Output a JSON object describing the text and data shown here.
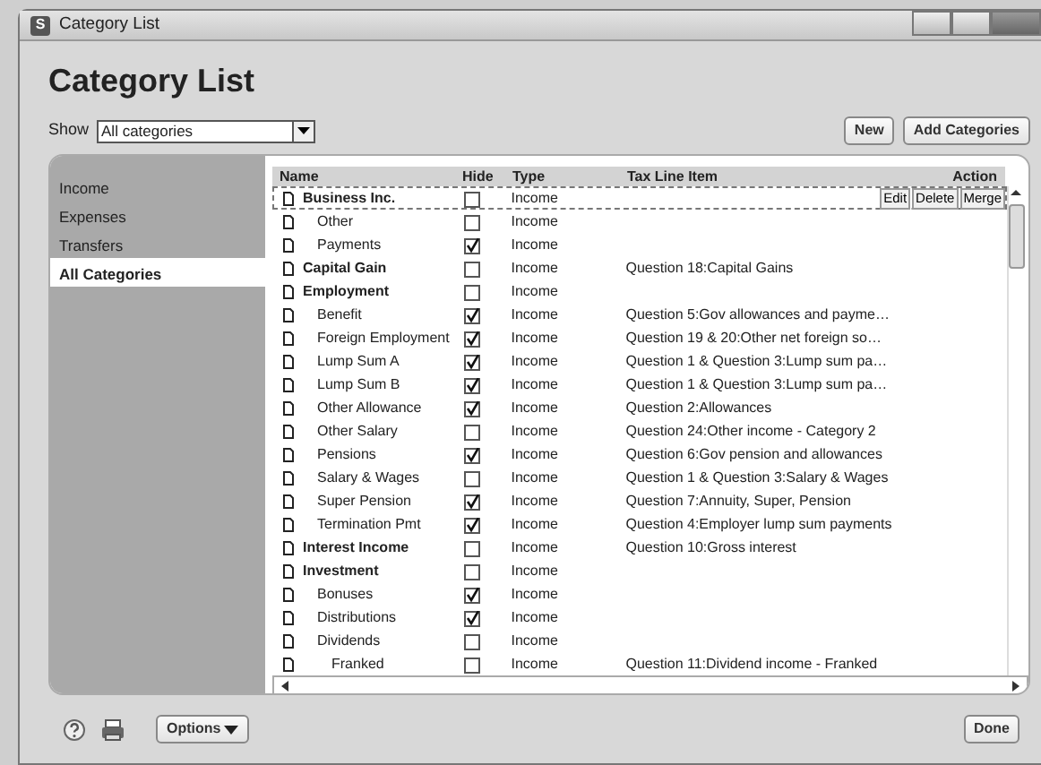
{
  "window": {
    "title": "Category List",
    "app_icon": "S"
  },
  "heading": "Category List",
  "show": {
    "label": "Show",
    "value": "All categories"
  },
  "buttons": [
    "New",
    "Add Categories"
  ],
  "sidebar": {
    "items": [
      {
        "label": "Income",
        "selected": false
      },
      {
        "label": "Expenses",
        "selected": false
      },
      {
        "label": "Transfers",
        "selected": false
      },
      {
        "label": "All Categories",
        "selected": true
      }
    ]
  },
  "table": {
    "columns": [
      "Name",
      "Hide",
      "Type",
      "Tax Line Item",
      "Action"
    ],
    "rows": [
      {
        "name": "Business Inc.",
        "hidden": false,
        "type": "Income",
        "selected": true,
        "actions": [
          "Edit",
          "Delete",
          "Merge"
        ],
        "children": [
          {
            "name": "Other",
            "hidden": false,
            "type": "Income",
            "selected": false
          },
          {
            "name": "Payments",
            "hidden": true,
            "type": "Income",
            "selected": false
          }
        ]
      },
      {
        "name": "Capital Gain",
        "hidden": false,
        "type": "Income",
        "tax_line": "Question 18:Capital Gains",
        "selected": false
      },
      {
        "name": "Employment",
        "hidden": false,
        "type": "Income",
        "selected": false,
        "children": [
          {
            "name": "Benefit",
            "hidden": true,
            "type": "Income",
            "tax_line": "Question 5:Gov allowances and payme…",
            "selected": false
          },
          {
            "name": "Foreign Employment",
            "hidden": true,
            "type": "Income",
            "tax_line": "Question 19 & 20:Other net foreign so…",
            "selected": false
          },
          {
            "name": "Lump Sum A",
            "hidden": true,
            "type": "Income",
            "tax_line": "Question 1 & Question 3:Lump sum pa…",
            "selected": false
          },
          {
            "name": "Lump Sum B",
            "hidden": true,
            "type": "Income",
            "tax_line": "Question 1 & Question 3:Lump sum pa…",
            "selected": false
          },
          {
            "name": "Other Allowance",
            "hidden": true,
            "type": "Income",
            "tax_line": "Question 2:Allowances",
            "selected": false
          },
          {
            "name": "Other Salary",
            "hidden": false,
            "type": "Income",
            "tax_line": "Question 24:Other income - Category 2",
            "selected": false
          },
          {
            "name": "Pensions",
            "hidden": true,
            "type": "Income",
            "tax_line": "Question 6:Gov pension and allowances",
            "selected": false
          },
          {
            "name": "Salary & Wages",
            "hidden": false,
            "type": "Income",
            "tax_line": "Question 1 & Question 3:Salary & Wages",
            "selected": false
          },
          {
            "name": "Super Pension",
            "hidden": true,
            "type": "Income",
            "tax_line": "Question 7:Annuity, Super, Pension",
            "selected": false
          },
          {
            "name": "Termination Pmt",
            "hidden": true,
            "type": "Income",
            "tax_line": "Question 4:Employer lump sum payments",
            "selected": false
          }
        ]
      },
      {
        "name": "Interest Income",
        "hidden": false,
        "type": "Income",
        "tax_line": "Question 10:Gross interest",
        "selected": false
      },
      {
        "name": "Investment",
        "hidden": false,
        "type": "Income",
        "selected": false,
        "children": [
          {
            "name": "Bonuses",
            "hidden": true,
            "type": "Income",
            "selected": false
          },
          {
            "name": "Distributions",
            "hidden": true,
            "type": "Income",
            "selected": false
          },
          {
            "name": "Dividends",
            "hidden": false,
            "type": "Income",
            "selected": false,
            "children": [
              {
                "name": "Franked",
                "hidden": false,
                "type": "Income",
                "tax_line": "Question 11:Dividend income - Franked",
                "selected": false
              }
            ]
          }
        ]
      }
    ]
  },
  "footer": {
    "options": "Options",
    "done": "Done"
  }
}
